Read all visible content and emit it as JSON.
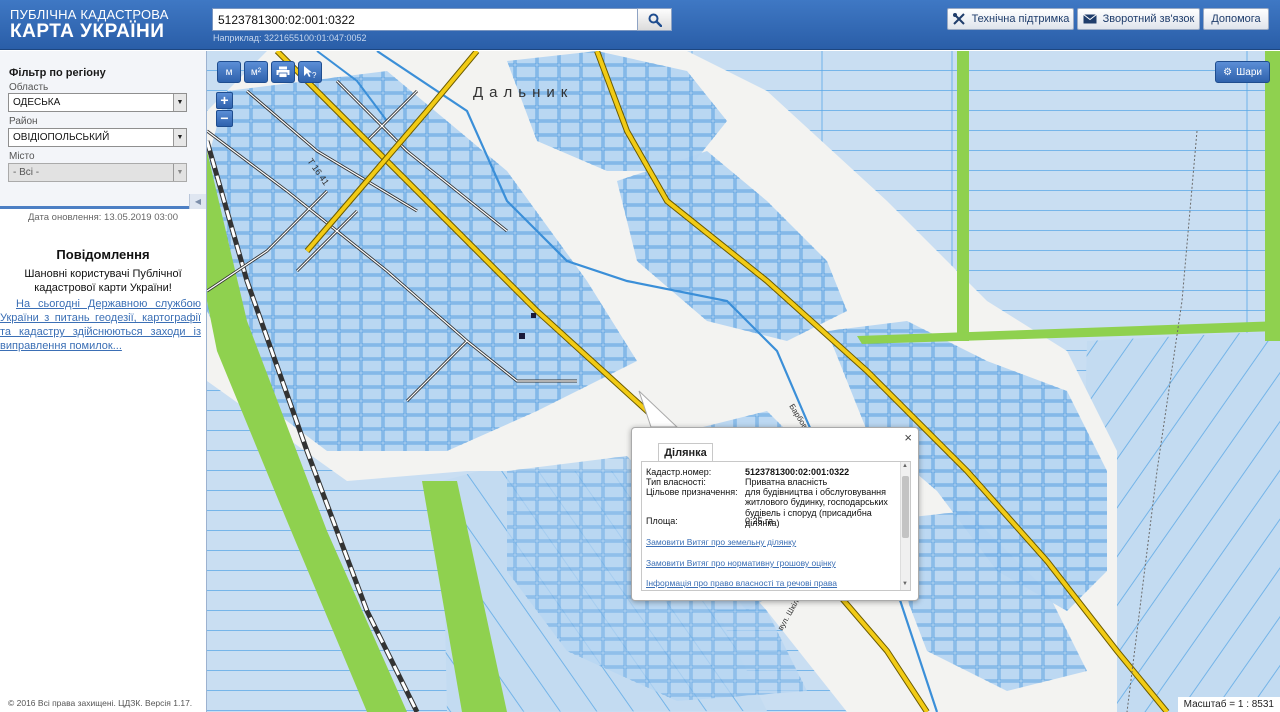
{
  "header": {
    "logo_line1": "ПУБЛІЧНА КАДАСТРОВА",
    "logo_line2": "КАРТА УКРАЇНИ",
    "search_value": "5123781300:02:001:0322",
    "search_hint": "Наприклад: 3221655100:01:047:0052",
    "support_label": "Технічна підтримка",
    "feedback_label": "Зворотний зв'язок",
    "help_label": "Допомога"
  },
  "sidebar": {
    "filter_title": "Фільтр по регіону",
    "oblast_label": "Область",
    "oblast_value": "ОДЕСЬКА",
    "raion_label": "Район",
    "raion_value": "ОВІДІОПОЛЬСЬКИЙ",
    "misto_label": "Місто",
    "misto_value": "- Всі -",
    "update_date": "Дата оновлення: 13.05.2019 03:00",
    "notice_title": "Повідомлення",
    "notice_body": "Шановні користувачі Публічної кадастрової карти України!",
    "notice_link": "На сьогодні Державною службою України з питань геодезії, картографії та кадастру здійснюються заходи із виправлення помилок...",
    "copyright": "© 2016 Всі права захищені. ЦДЗК. Версія 1.17."
  },
  "map": {
    "tool_measure_line": "м",
    "tool_measure_area": "м²",
    "zoom_in": "+",
    "zoom_out": "−",
    "layers_label": "Шари",
    "place_name": "Дальник",
    "road_label": "Т 16 41",
    "street_label1": "вул. Шкільна",
    "street_label2": "Барбов",
    "scale_text": "Масштаб = 1 : 8531",
    "colors": {
      "water": "#c9def2",
      "parcel": "#a6cbee",
      "land": "#f4f4f2",
      "road": "#f2cb15",
      "green": "#8fd14f"
    }
  },
  "popup": {
    "close": "×",
    "tab_label": "Ділянка",
    "fields": [
      {
        "key": "Кадастр.номер:",
        "value": "5123781300:02:001:0322"
      },
      {
        "key": "Тип власності:",
        "value": "Приватна власність"
      },
      {
        "key": "Цільове призначення:",
        "value": "для будівництва і обслуговування житлового будинку, господарських будівель і споруд (присадибна ділянка)"
      },
      {
        "key": "Площа:",
        "value": "0.25 га"
      }
    ],
    "links": [
      "Замовити Витяг про земельну ділянку",
      "Замовити Витяг про нормативну грошову оцінку",
      "Інформація про право власності та речові права"
    ]
  }
}
